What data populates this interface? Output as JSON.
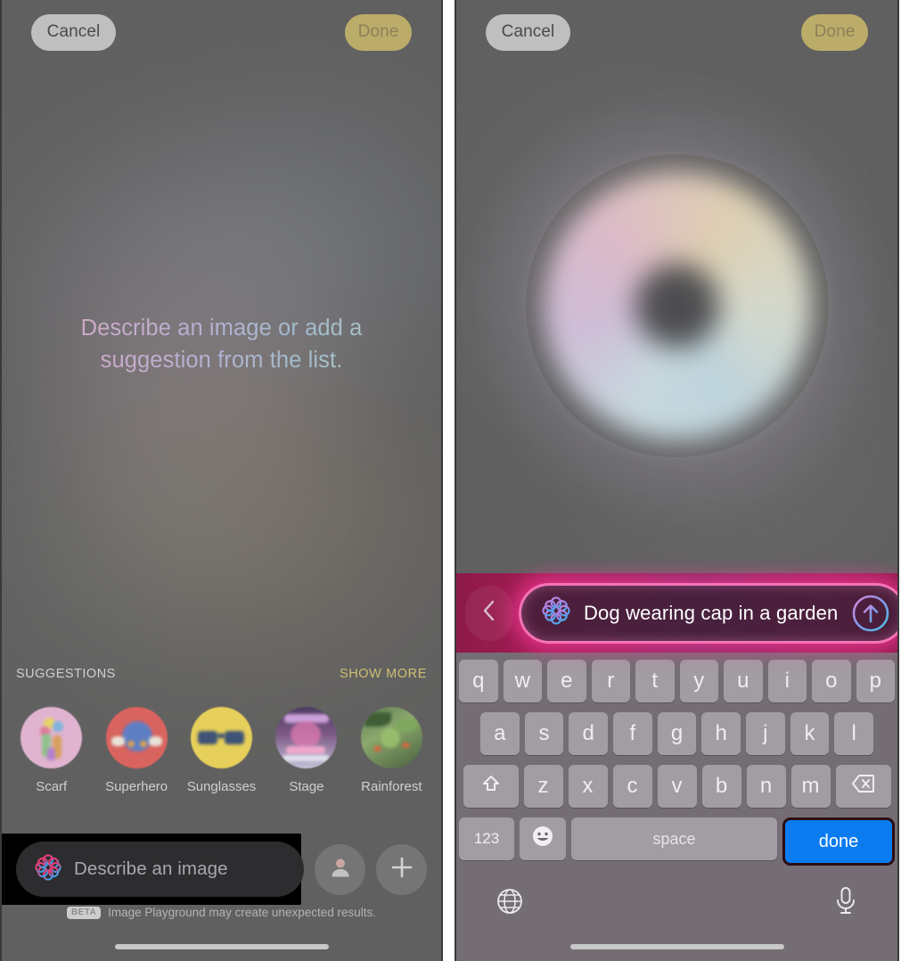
{
  "left_panel": {
    "topbar": {
      "cancel_label": "Cancel",
      "done_label": "Done"
    },
    "hero_text": "Describe an image or add a suggestion from the list.",
    "suggestions": {
      "section_title": "SUGGESTIONS",
      "show_more_label": "SHOW MORE",
      "items": [
        {
          "label": "Scarf"
        },
        {
          "label": "Superhero"
        },
        {
          "label": "Sunglasses"
        },
        {
          "label": "Stage"
        },
        {
          "label": "Rainforest"
        }
      ]
    },
    "input_bar": {
      "placeholder": "Describe an image",
      "ai_icon": "apple-intelligence-icon",
      "person_icon": "person-icon",
      "add_icon": "plus-icon"
    },
    "disclaimer": {
      "badge": "BETA",
      "text": "Image Playground may create unexpected results."
    }
  },
  "right_panel": {
    "topbar": {
      "cancel_label": "Cancel",
      "done_label": "Done"
    },
    "prompt_bar": {
      "back_icon": "chevron-left-icon",
      "ai_icon": "apple-intelligence-icon",
      "value": "Dog wearing cap in a garden",
      "send_icon": "arrow-up-circle-icon"
    },
    "keyboard": {
      "row1": [
        "q",
        "w",
        "e",
        "r",
        "t",
        "y",
        "u",
        "i",
        "o",
        "p"
      ],
      "row2": [
        "a",
        "s",
        "d",
        "f",
        "g",
        "h",
        "j",
        "k",
        "l"
      ],
      "row3_letters": [
        "z",
        "x",
        "c",
        "v",
        "b",
        "n",
        "m"
      ],
      "shift_icon": "shift-arrow-icon",
      "backspace_icon": "backspace-icon",
      "numbers_label": "123",
      "emoji_icon": "emoji-smiley-icon",
      "space_label": "space",
      "done_label": "done",
      "globe_icon": "globe-icon",
      "mic_icon": "microphone-icon"
    }
  },
  "colors": {
    "accent_blue": "#0a7cf0",
    "done_gold": "#cdbf72",
    "prompt_glow_pink": "#ff3ca0",
    "keyboard_bg": "#767076"
  }
}
